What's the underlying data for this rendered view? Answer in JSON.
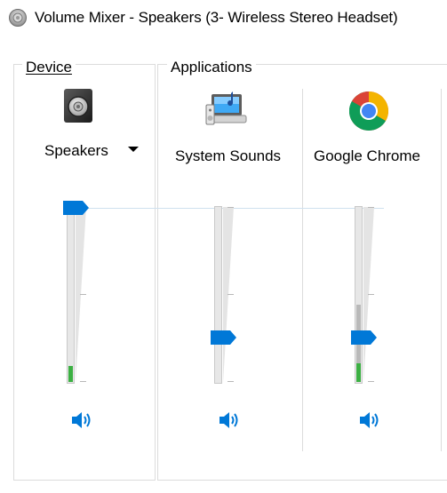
{
  "window": {
    "title": "Volume Mixer - Speakers (3- Wireless Stereo Headset)",
    "title_icon": "speaker-icon"
  },
  "device": {
    "group_label": "Device",
    "name": "Speakers",
    "icon": "speaker-device-icon",
    "volume_level": 1.0,
    "peak_level": 0.09,
    "mute_icon": "volume-icon",
    "has_dropdown": true
  },
  "applications": {
    "group_label": "Applications",
    "items": [
      {
        "name": "System Sounds",
        "icon": "system-sounds-icon",
        "volume_level": 0.25,
        "peak_level": 0.0,
        "mute_icon": "volume-icon"
      },
      {
        "name": "Google Chrome",
        "icon": "chrome-icon",
        "volume_level": 0.25,
        "peak_level": 0.1,
        "peak_gray_level": 0.45,
        "mute_icon": "volume-icon"
      }
    ]
  },
  "colors": {
    "accent": "#0078d7",
    "peak_green": "#3cb043",
    "track": "#e7e7e7",
    "border": "#dcdcdc"
  }
}
